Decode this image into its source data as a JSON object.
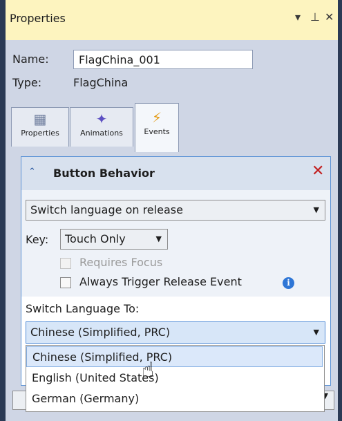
{
  "window": {
    "title": "Properties",
    "buttons": [
      "▾",
      "⊥",
      "✕"
    ]
  },
  "header": {
    "name_label": "Name:",
    "name_value": "FlagChina_001",
    "type_label": "Type:",
    "type_value": "FlagChina"
  },
  "tabs": [
    {
      "label": "Properties",
      "icon": "properties-icon"
    },
    {
      "label": "Animations",
      "icon": "animations-icon"
    },
    {
      "label": "Events",
      "icon": "lightning-icon",
      "active": true
    }
  ],
  "behavior": {
    "title": "Button Behavior",
    "action_value": "Switch language on release",
    "key_label": "Key:",
    "key_value": "Touch Only",
    "requires_focus_label": "Requires Focus",
    "always_trigger_label": "Always Trigger Release Event",
    "switch_to_label": "Switch Language To:",
    "language_value": "Chinese (Simplified, PRC)"
  },
  "dropdown_options": [
    "Chinese (Simplified, PRC)",
    "English (United States)",
    "German (Germany)"
  ],
  "colors": {
    "titlebar": "#fdf4bf",
    "panel": "#cfd6e5",
    "accent_border": "#5d93d6",
    "close_red": "#c21e1e",
    "highlight": "#dbe8fa"
  }
}
